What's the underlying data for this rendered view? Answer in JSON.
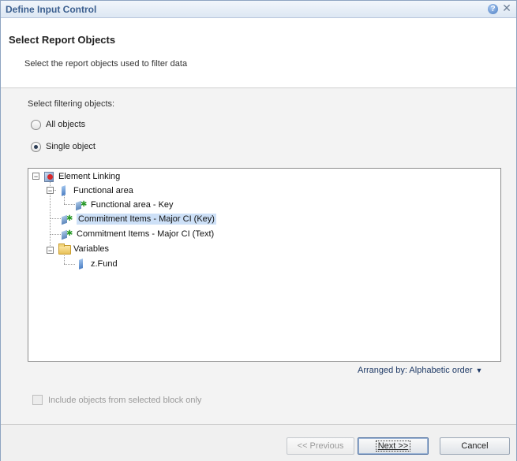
{
  "window": {
    "title": "Define Input Control",
    "help_glyph": "?",
    "close_glyph": "✕"
  },
  "header": {
    "title": "Select Report Objects",
    "subtitle": "Select the report objects used to filter data"
  },
  "filtering": {
    "label": "Select filtering objects:",
    "options": [
      {
        "label": "All objects",
        "selected": false
      },
      {
        "label": "Single object",
        "selected": true
      }
    ]
  },
  "tree": {
    "nodes": [
      {
        "label": "Element Linking",
        "icon": "universe-icon",
        "expanded": true
      },
      {
        "label": "Functional area",
        "icon": "dimension-icon",
        "expanded": true
      },
      {
        "label": "Functional area - Key",
        "icon": "detail-icon"
      },
      {
        "label": "Commitment Items - Major CI (Key)",
        "icon": "detail-icon",
        "selected": true
      },
      {
        "label": "Commitment Items - Major CI (Text)",
        "icon": "detail-icon"
      },
      {
        "label": "Variables",
        "icon": "folder-icon",
        "expanded": true
      },
      {
        "label": "z.Fund",
        "icon": "dimension-icon"
      }
    ],
    "expander_minus": "−"
  },
  "arranged_by": {
    "label": "Arranged by: Alphabetic order",
    "caret": "▼"
  },
  "include_block": {
    "label": "Include objects from selected block only",
    "checked": false,
    "enabled": false
  },
  "buttons": {
    "previous": "<< Previous",
    "next": "Next >>",
    "cancel": "Cancel"
  },
  "colors": {
    "title_text": "#3b5f8f",
    "selection": "#cde0f7"
  }
}
